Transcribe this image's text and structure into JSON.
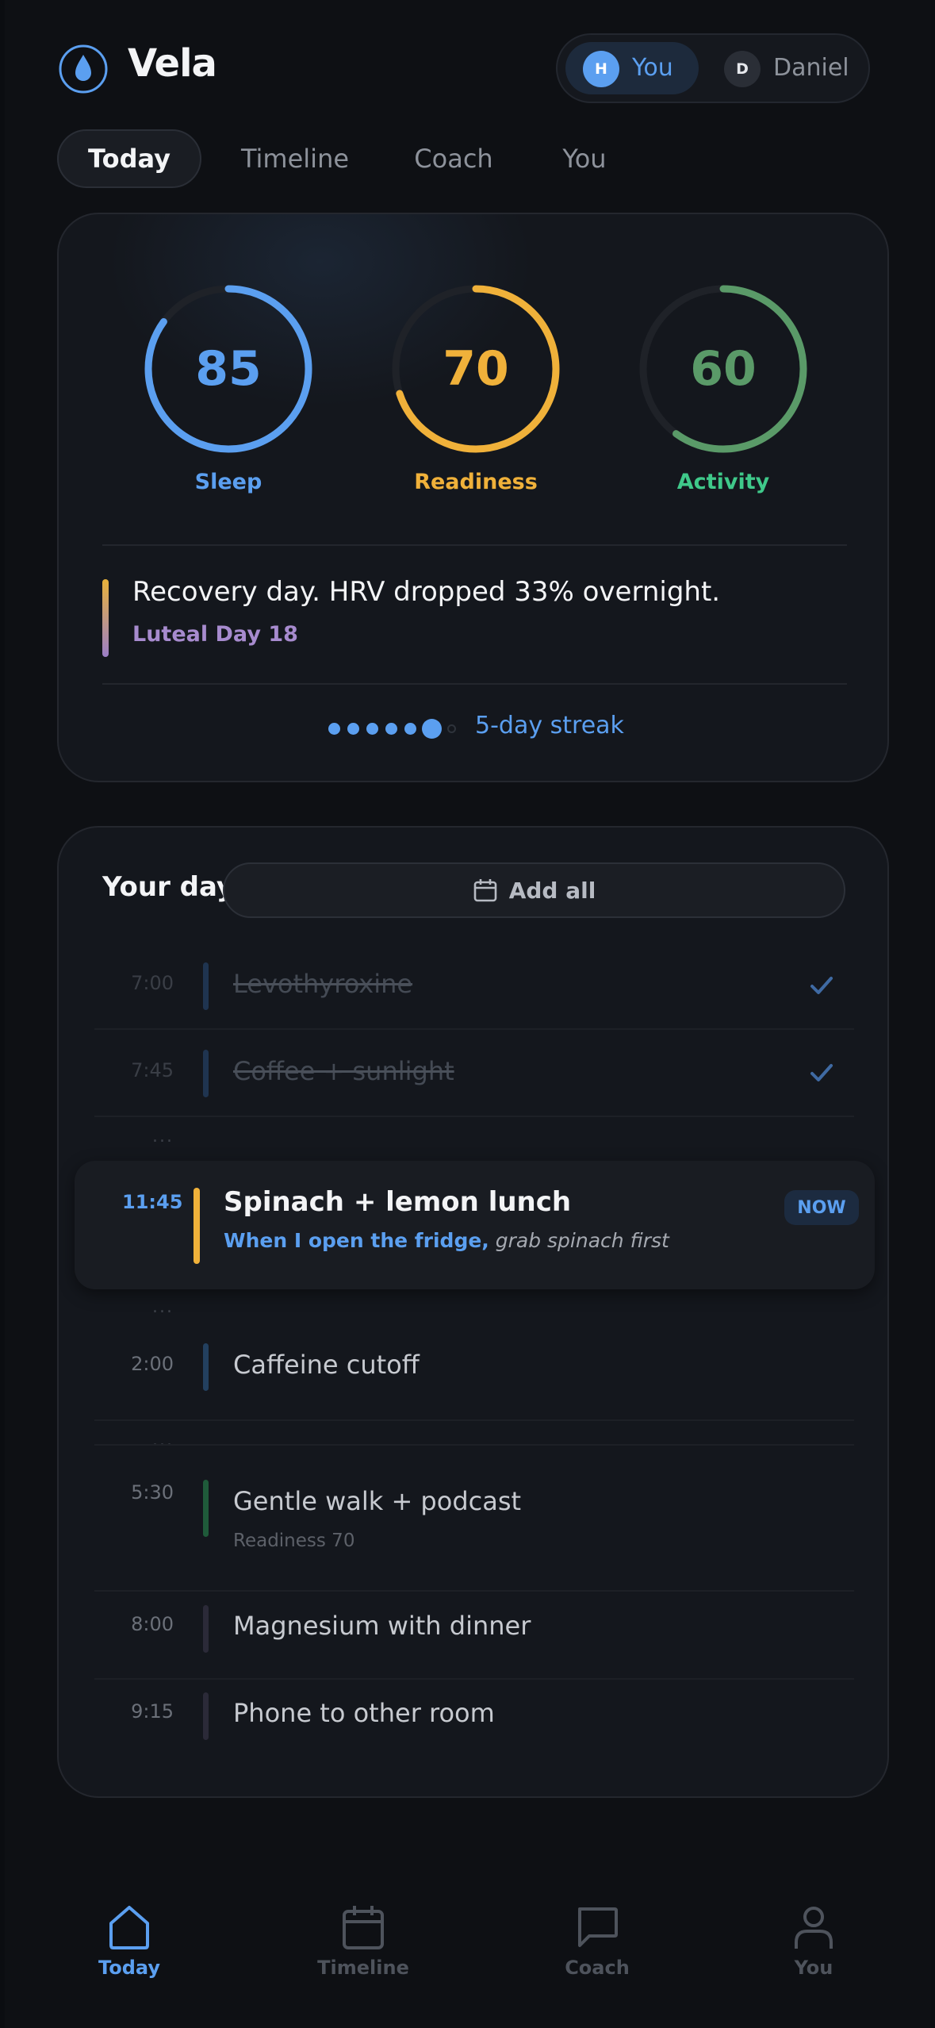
{
  "app": {
    "name": "Vela"
  },
  "profiles": [
    {
      "initial": "H",
      "label": "You",
      "selected": true
    },
    {
      "initial": "D",
      "label": "Daniel",
      "selected": false
    }
  ],
  "tabs": [
    "Today",
    "Timeline",
    "Coach",
    "You"
  ],
  "scores": [
    {
      "label": "Sleep",
      "value": "85",
      "fraction": 0.85,
      "color": "#5b9ff0"
    },
    {
      "label": "Readiness",
      "value": "70",
      "fraction": 0.7,
      "color": "#f0b13a"
    },
    {
      "label": "Activity",
      "value": "60",
      "fraction": 0.6,
      "color": "#5a9a68"
    }
  ],
  "insight": {
    "headline": "Recovery day. HRV dropped 33% overnight.",
    "cycle": "Luteal Day 18"
  },
  "streak": {
    "label": "5-day streak",
    "filled": 5,
    "total": 7
  },
  "day": {
    "title": "Your day",
    "add_all_label": "Add all",
    "items": [
      {
        "time": "7:00",
        "title": "Levothyroxine",
        "done": true
      },
      {
        "time": "7:45",
        "title": "Coffee + sunlight",
        "done": true
      },
      {
        "time": "11:45",
        "title": "Spinach + lemon lunch",
        "trigger": "When I open the fridge,",
        "action": "grab spinach first",
        "badge": "NOW"
      },
      {
        "time": "2:00",
        "title": "Caffeine cutoff"
      },
      {
        "time": "5:30",
        "title": "Gentle walk + podcast",
        "note": "Readiness 70"
      },
      {
        "time": "8:00",
        "title": "Magnesium with dinner"
      },
      {
        "time": "9:15",
        "title": "Phone to other room"
      }
    ],
    "gap_marker": "..."
  },
  "bottom_nav": [
    {
      "label": "Today",
      "icon": "home-icon",
      "active": true
    },
    {
      "label": "Timeline",
      "icon": "calendar-icon",
      "active": false
    },
    {
      "label": "Coach",
      "icon": "chat-icon",
      "active": false
    },
    {
      "label": "You",
      "icon": "person-icon",
      "active": false
    }
  ]
}
